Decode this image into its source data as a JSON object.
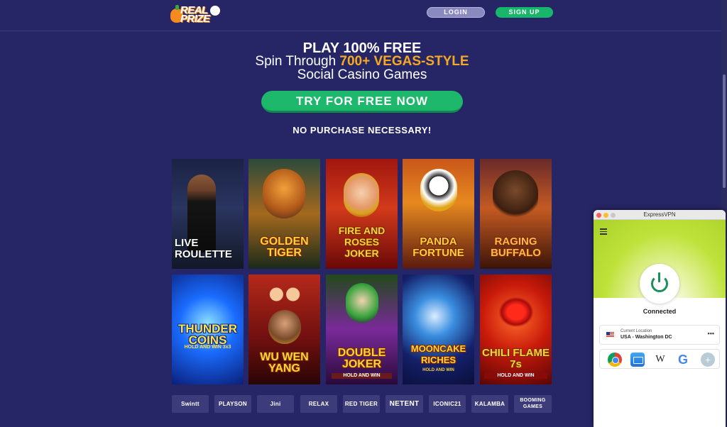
{
  "header": {
    "logo_text": "REAL PRIZE",
    "login_label": "LOGIN",
    "signup_label": "SIGN UP"
  },
  "hero": {
    "line1": "PLAY 100% FREE",
    "line2_prefix": "Spin Through ",
    "line2_accent": "700+ VEGAS-STYLE",
    "line3": "Social Casino Games",
    "cta_label": "TRY FOR FREE NOW",
    "disclaimer": "NO PURCHASE NECESSARY!"
  },
  "games": [
    {
      "title": "LIVE ROULETTE",
      "subtitle": ""
    },
    {
      "title": "GOLDEN TIGER",
      "subtitle": ""
    },
    {
      "title": "FIRE AND ROSES JOKER",
      "subtitle": ""
    },
    {
      "title": "PANDA FORTUNE",
      "subtitle": ""
    },
    {
      "title": "RAGING BUFFALO",
      "subtitle": ""
    },
    {
      "title": "THUNDER COINS",
      "subtitle": "HOLD AND WIN 3x3"
    },
    {
      "title": "WU WEN YANG",
      "subtitle": ""
    },
    {
      "title": "DOUBLE JOKER",
      "subtitle": "HOLD AND WIN"
    },
    {
      "title": "MOONCAKE RICHES",
      "subtitle": "HOLD AND WIN"
    },
    {
      "title": "CHILI FLAME 7s",
      "subtitle": "HOLD AND WIN"
    }
  ],
  "providers": [
    "Swintt",
    "PLAYSON",
    "Jini",
    "RELAX",
    "RED TIGER",
    "NETENT",
    "ICONIC21",
    "KALAMBA",
    "BOOMING GAMES"
  ],
  "vpn": {
    "window_title": "ExpressVPN",
    "status": "Connected",
    "location_label": "Current Location",
    "location_value": "USA - Washington DC",
    "more_label": "•••",
    "wiki_glyph": "W",
    "google_glyph": "G",
    "add_glyph": "+"
  },
  "colors": {
    "background": "#262666",
    "accent": "#f7a823",
    "cta": "#1db86b",
    "vpn_green": "#bfe23a"
  }
}
